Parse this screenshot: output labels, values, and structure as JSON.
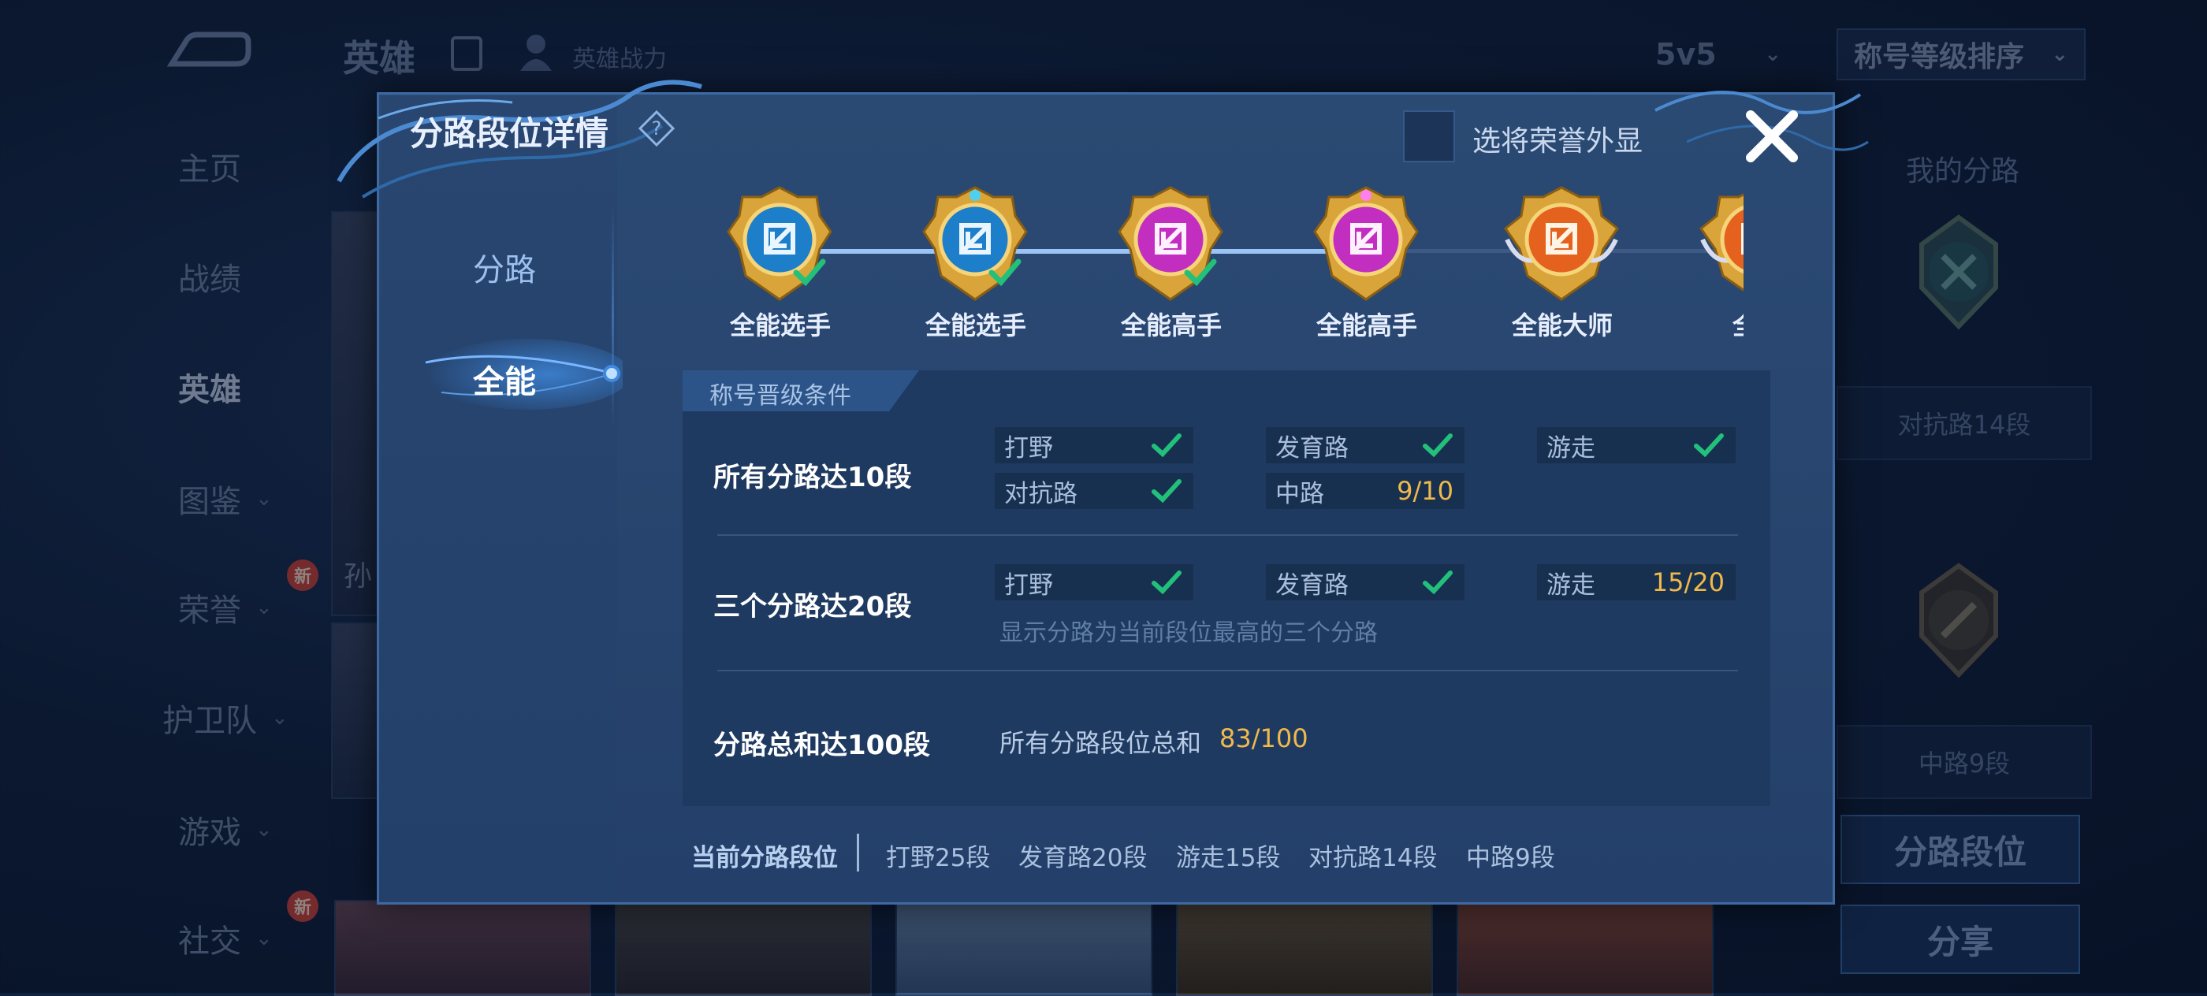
{
  "background": {
    "title": "英雄",
    "power_label": "英雄战力",
    "mode_select": "5v5",
    "sort_select": "称号等级排序",
    "nav": [
      {
        "label": "主页"
      },
      {
        "label": "战绩"
      },
      {
        "label": "英雄"
      },
      {
        "label": "图鉴"
      },
      {
        "label": "荣誉",
        "badge": "新"
      },
      {
        "label": "护卫队"
      },
      {
        "label": "游戏"
      },
      {
        "label": "社交",
        "badge": "新"
      }
    ],
    "hero_card_partial_text": "孙",
    "right_panel": {
      "title": "我的分路",
      "lane1_label": "对抗路14段",
      "lane2_label": "中路9段",
      "lane_rank_button": "分路段位",
      "share_button": "分享"
    }
  },
  "dialog": {
    "title": "分路段位详情",
    "honor_checkbox_label": "选将荣誉外显",
    "tabs": [
      {
        "label": "分路",
        "active": false
      },
      {
        "label": "全能",
        "active": true
      }
    ],
    "medals": [
      {
        "label": "全能选手",
        "color": "blue",
        "achieved": true
      },
      {
        "label": "全能选手",
        "color": "blue",
        "achieved": true
      },
      {
        "label": "全能高手",
        "color": "purple",
        "achieved": true
      },
      {
        "label": "全能高手",
        "color": "purple",
        "achieved": false
      },
      {
        "label": "全能大师",
        "color": "orange",
        "achieved": false
      },
      {
        "label": "全能",
        "color": "orange",
        "achieved": false
      }
    ],
    "conditions_header": "称号晋级条件",
    "conditions": {
      "row1": {
        "label": "所有分路达10段",
        "cells": [
          {
            "lane": "打野",
            "status": "check"
          },
          {
            "lane": "发育路",
            "status": "check"
          },
          {
            "lane": "游走",
            "status": "check"
          },
          {
            "lane": "对抗路",
            "status": "check"
          },
          {
            "lane": "中路",
            "progress": "9/10"
          }
        ]
      },
      "row2": {
        "label": "三个分路达20段",
        "cells": [
          {
            "lane": "打野",
            "status": "check"
          },
          {
            "lane": "发育路",
            "status": "check"
          },
          {
            "lane": "游走",
            "progress": "15/20"
          }
        ],
        "hint": "显示分路为当前段位最高的三个分路"
      },
      "row3": {
        "label": "分路总和达100段",
        "sum_label": "所有分路段位总和",
        "sum_value": "83/100"
      }
    },
    "current_label": "当前分路段位",
    "current_lanes": [
      "打野25段",
      "发育路20段",
      "游走15段",
      "对抗路14段",
      "中路9段"
    ]
  },
  "colors": {
    "accent_check": "#22c07a",
    "progress_text": "#f0b94b",
    "dialog_bg": "#2b4a73"
  }
}
